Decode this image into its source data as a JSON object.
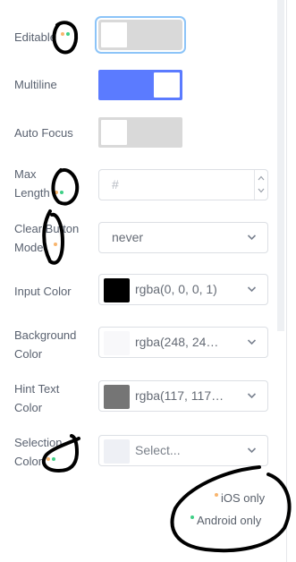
{
  "props": {
    "editable": {
      "label": "Editable",
      "value": false,
      "platform": "both"
    },
    "multiline": {
      "label": "Multiline",
      "value": true
    },
    "auto_focus": {
      "label": "Auto Focus",
      "value": false
    },
    "max_length": {
      "label_1": "Max",
      "label_2": "Length",
      "placeholder": "#",
      "platform": "both"
    },
    "clear_button_mode": {
      "label_1": "Clear Button",
      "label_2": "Mode",
      "value": "never",
      "platform": "ios"
    },
    "input_color": {
      "label": "Input Color",
      "value": "rgba(0, 0, 0, 1)",
      "swatch": "#000000"
    },
    "background_color": {
      "label_1": "Background",
      "label_2": "Color",
      "value": "rgba(248, 24…",
      "swatch": "#f8f8fa"
    },
    "hint_text_color": {
      "label_1": "Hint Text",
      "label_2": "Color",
      "value": "rgba(117, 117…",
      "swatch": "#757575"
    },
    "selection_color": {
      "label_1": "Selection",
      "label_2": "Color",
      "placeholder": "Select...",
      "swatch": "#eef0f5",
      "platform": "both"
    }
  },
  "legend": {
    "ios": "iOS only",
    "android": "Android only"
  },
  "colors": {
    "accent": "#5b7bff",
    "ios_dot": "#f8b56e",
    "android_dot": "#3fcf86",
    "annotation_ink": "#000000"
  }
}
